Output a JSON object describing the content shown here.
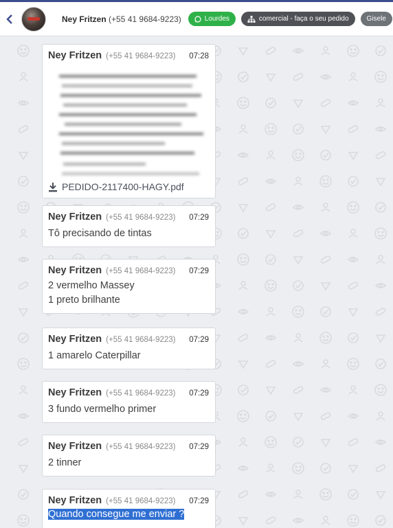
{
  "header": {
    "contact_name": "Ney Fritzen",
    "contact_phone": "(+55 41 9684-9223)",
    "tags": [
      {
        "label": "Lourdes",
        "icon": "whatsapp-icon",
        "color": "#2fb14a"
      },
      {
        "label": "comercial - faça o seu pedido",
        "icon": "sitemap-icon",
        "color": "#4f5156"
      },
      {
        "label": "Gisele",
        "color": "#6e7378"
      }
    ]
  },
  "messages": [
    {
      "sender": "Ney Fritzen",
      "phone": "(+55 41 9684-9223)",
      "time": "07:28",
      "attachment": {
        "type": "pdf",
        "filename": "PEDIDO-2117400-HAGY.pdf",
        "icon": "download-icon"
      }
    },
    {
      "sender": "Ney Fritzen",
      "phone": "(+55 41 9684-9223)",
      "time": "07:29",
      "lines": [
        "Tô precisando de tintas"
      ]
    },
    {
      "sender": "Ney Fritzen",
      "phone": "(+55 41 9684-9223)",
      "time": "07:29",
      "lines": [
        "2 vermelho Massey",
        "1 preto brilhante"
      ]
    },
    {
      "sender": "Ney Fritzen",
      "phone": "(+55 41 9684-9223)",
      "time": "07:29",
      "lines": [
        "1 amarelo Caterpillar"
      ]
    },
    {
      "sender": "Ney Fritzen",
      "phone": "(+55 41 9684-9223)",
      "time": "07:29",
      "lines": [
        "3 fundo vermelho primer"
      ]
    },
    {
      "sender": "Ney Fritzen",
      "phone": "(+55 41 9684-9223)",
      "time": "07:29",
      "lines": [
        "2 tinner"
      ]
    },
    {
      "sender": "Ney Fritzen",
      "phone": "(+55 41 9684-9223)",
      "time": "07:29",
      "lines": [
        "Quando consegue me enviar ?"
      ],
      "selected": true
    }
  ],
  "colors": {
    "accent": "#3e4d8c",
    "selection": "#2f6fd3",
    "chat_bg": "#eceef2"
  }
}
